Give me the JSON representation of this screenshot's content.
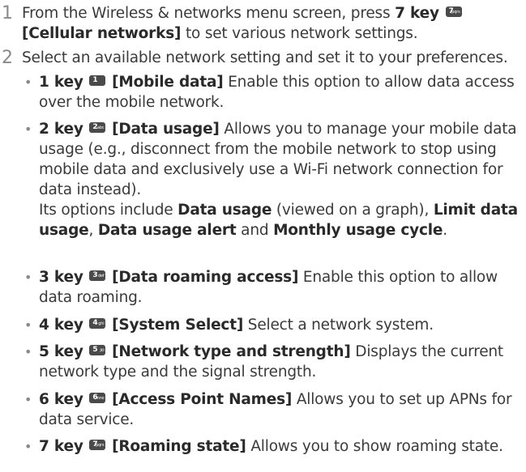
{
  "steps": [
    {
      "number": "1",
      "pre": "From the Wireless & networks menu screen, press ",
      "key_bold": "7 key",
      "key_icon": "7",
      "key_letters": "pqrs",
      "label_bold": "[Cellular networks]",
      "post": " to set various network settings."
    },
    {
      "number": "2",
      "text": "Select an available network setting and set it to your preferences."
    }
  ],
  "bullets": [
    {
      "key": "1 key",
      "icon": "1",
      "letters": "",
      "label": "[Mobile data]",
      "desc": " Enable this option to allow data access over the mobile network."
    },
    {
      "key": "2 key",
      "icon": "2",
      "letters": "abc",
      "label": "[Data usage]",
      "desc": " Allows you to manage your mobile data usage (e.g., disconnect from the mobile network to stop using mobile data and exclusively use a Wi-Fi network connection for data instead).",
      "extra": {
        "pre": "Its options include ",
        "b1": "Data usage",
        "m1": " (viewed on a graph), ",
        "b2": "Limit data usage",
        "m2": ", ",
        "b3": "Data usage alert",
        "m3": " and ",
        "b4": "Monthly usage cycle",
        "end": "."
      }
    },
    {
      "key": "3 key",
      "icon": "3",
      "letters": "def",
      "label": "[Data roaming access]",
      "desc": " Enable this option to allow data roaming."
    },
    {
      "key": "4 key",
      "icon": "4",
      "letters": "ghi",
      "label": "[System Select]",
      "desc": " Select a network system."
    },
    {
      "key": "5 key",
      "icon": "5",
      "letters": "jkl",
      "label": "[Network type and strength]",
      "desc": " Displays the current network type and the signal strength."
    },
    {
      "key": "6 key",
      "icon": "6",
      "letters": "mno",
      "label": "[Access Point Names]",
      "desc": " Allows you to set up APNs for data service."
    },
    {
      "key": "7 key",
      "icon": "7",
      "letters": "pqrs",
      "label": "[Roaming state]",
      "desc": " Allows you to show roaming state."
    }
  ],
  "bullet_glyph": "•"
}
